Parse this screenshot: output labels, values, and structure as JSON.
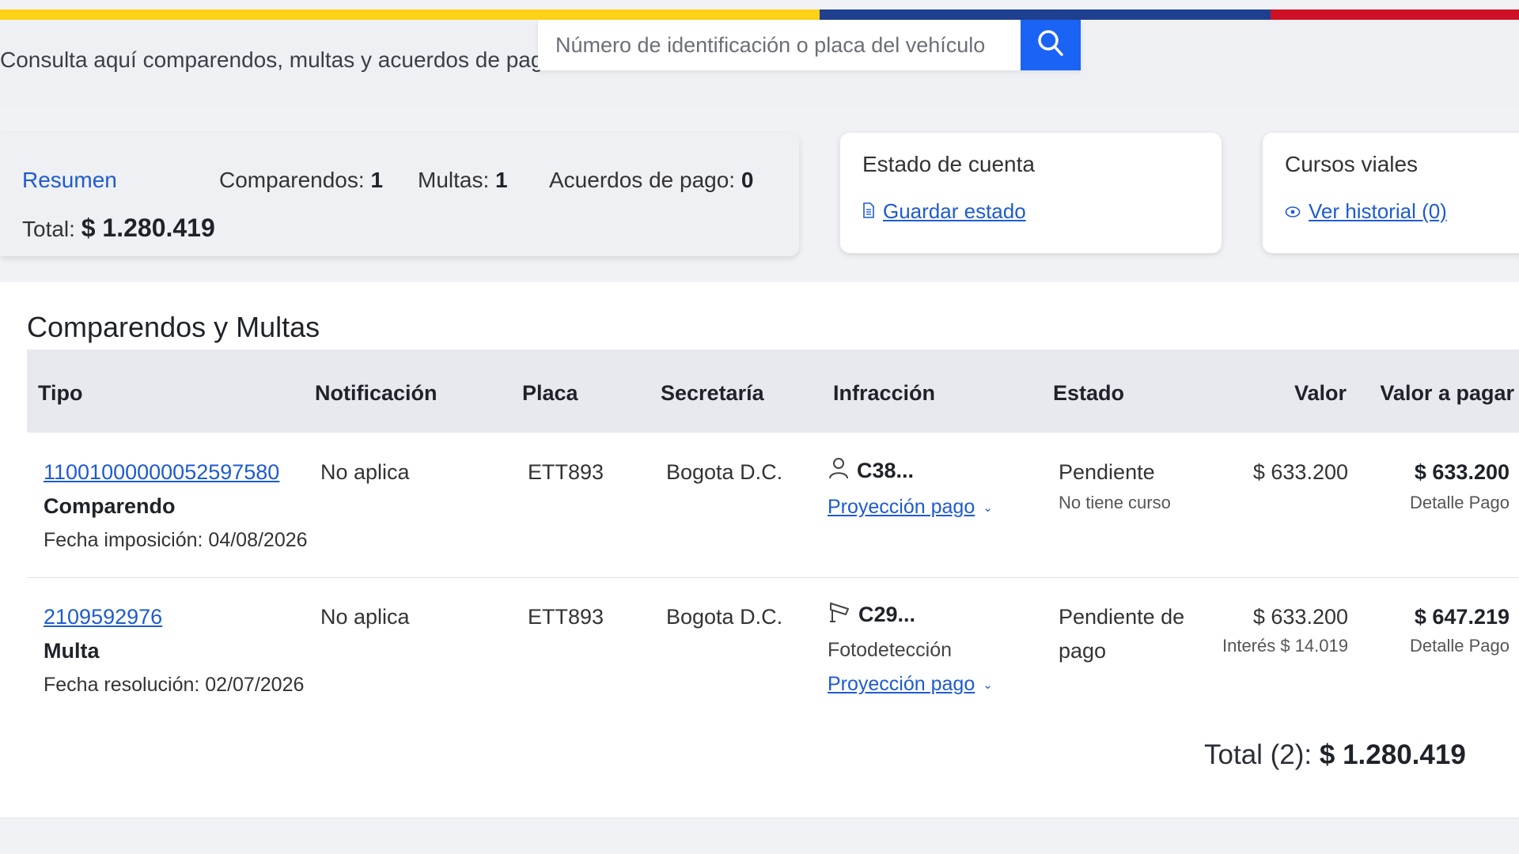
{
  "colors": {
    "flag_yellow": "#fcd116",
    "flag_blue": "#1f3f8f",
    "flag_red": "#ce1126",
    "accent": "#1a63f5"
  },
  "header": {
    "intro": "Consulta aquí comparendos, multas y acuerdos de pago",
    "search_placeholder": "Número de identificación o placa del vehículo",
    "search_icon": "search-icon"
  },
  "summary": {
    "title": "Resumen",
    "comparendos_label": "Comparendos:",
    "comparendos_count": "1",
    "multas_label": "Multas:",
    "multas_count": "1",
    "acuerdos_label": "Acuerdos de pago:",
    "acuerdos_count": "0",
    "total_label": "Total:",
    "total_value": "$ 1.280.419"
  },
  "estado_cuenta": {
    "title": "Estado de cuenta",
    "action": "Guardar estado",
    "icon": "document-icon"
  },
  "cursos": {
    "title": "Cursos viales",
    "action": "Ver historial (0)",
    "icon": "eye-icon"
  },
  "table": {
    "title": "Comparendos y Multas",
    "headers": {
      "tipo": "Tipo",
      "notificacion": "Notificación",
      "placa": "Placa",
      "secretaria": "Secretaría",
      "infraccion": "Infracción",
      "estado": "Estado",
      "valor": "Valor",
      "valor_pagar": "Valor a pagar"
    },
    "rows": [
      {
        "numero": "11001000000052597580",
        "tipo": "Comparendo",
        "fecha": "Fecha imposición: 04/08/2026",
        "notificacion": "No aplica",
        "placa": "ETT893",
        "secretaria": "Bogota D.C.",
        "infraccion_icon": "person-icon",
        "infraccion": "C38...",
        "proyeccion": "Proyección pago",
        "estado": "Pendiente",
        "estado_sub": "No tiene curso",
        "valor": "$ 633.200",
        "valor_pagar": "$ 633.200",
        "detalle": "Detalle Pago"
      },
      {
        "numero": "2109592976",
        "tipo": "Multa",
        "fecha": "Fecha resolución: 02/07/2026",
        "notificacion": "No aplica",
        "placa": "ETT893",
        "secretaria": "Bogota D.C.",
        "infraccion_icon": "camera-icon",
        "infraccion": "C29...",
        "infraccion_sub": "Fotodetección",
        "proyeccion": "Proyección pago",
        "estado_line1": "Pendiente de",
        "estado_line2": "pago",
        "valor": "$ 633.200",
        "interes": "Interés $ 14.019",
        "valor_pagar": "$ 647.219",
        "detalle": "Detalle Pago"
      }
    ],
    "total_label": "Total (2):",
    "total_value": "$ 1.280.419"
  }
}
